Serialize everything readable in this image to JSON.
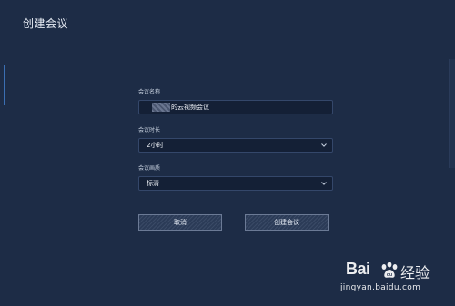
{
  "window": {
    "title": "创建会议"
  },
  "form": {
    "name": {
      "label": "会议名称",
      "value": "的云视频会议"
    },
    "duration": {
      "label": "会议时长",
      "selected": "2小时"
    },
    "quality": {
      "label": "会议画质",
      "selected": "标清"
    }
  },
  "buttons": {
    "cancel": "取消",
    "create": "创建会议"
  },
  "watermark": {
    "logo_text": "Bai",
    "logo_suffix": "经验",
    "url": "jingyan.baidu.com"
  },
  "colors": {
    "background": "#1d2c46",
    "field_bg": "#142036",
    "field_border": "#34476a",
    "button_border": "#6b7a95"
  }
}
